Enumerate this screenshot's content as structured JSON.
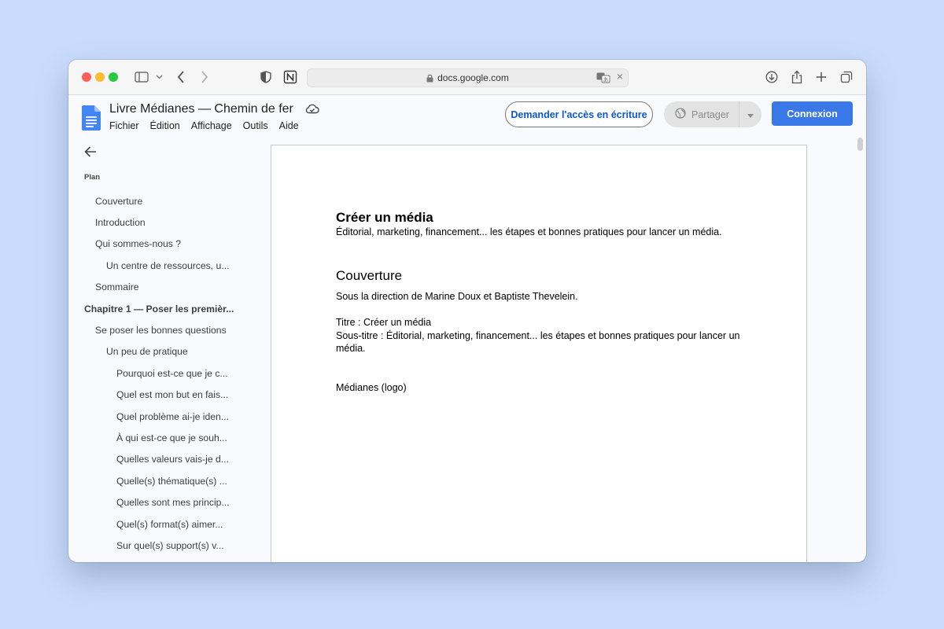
{
  "browser": {
    "url": "docs.google.com"
  },
  "docs": {
    "title": "Livre Médianes — Chemin de fer",
    "menu": [
      "Fichier",
      "Édition",
      "Affichage",
      "Outils",
      "Aide"
    ],
    "request_access_label": "Demander l'accès en écriture",
    "share_label": "Partager",
    "login_label": "Connexion",
    "brand_color": "#3b78e7"
  },
  "outline": {
    "heading": "Plan",
    "items": [
      {
        "label": "Couverture",
        "level": 1
      },
      {
        "label": "Introduction",
        "level": 1
      },
      {
        "label": "Qui sommes-nous ?",
        "level": 1
      },
      {
        "label": "Un centre de ressources, u...",
        "level": 2
      },
      {
        "label": "Sommaire",
        "level": 1
      },
      {
        "label": "Chapitre 1 — Poser les premièr...",
        "level": 0
      },
      {
        "label": "Se poser les bonnes questions",
        "level": 1
      },
      {
        "label": "Un peu de pratique",
        "level": 2
      },
      {
        "label": "Pourquoi est-ce que je c...",
        "level": 3
      },
      {
        "label": "Quel est mon but en fais...",
        "level": 3
      },
      {
        "label": "Quel problème ai-je iden...",
        "level": 3
      },
      {
        "label": "À qui est-ce que je souh...",
        "level": 3
      },
      {
        "label": "Quelles valeurs vais-je d...",
        "level": 3
      },
      {
        "label": "Quelle(s) thématique(s) ...",
        "level": 3
      },
      {
        "label": "Quelles sont mes princip...",
        "level": 3
      },
      {
        "label": "Quel(s) format(s) aimer...",
        "level": 3
      },
      {
        "label": "Sur quel(s) support(s) v...",
        "level": 3
      }
    ]
  },
  "document": {
    "title": "Créer un média",
    "subtitle": "Éditorial, marketing, financement... les étapes et bonnes pratiques pour lancer un média.",
    "section_heading": "Couverture",
    "direction": "Sous la direction de Marine Doux et Baptiste Thevelein.",
    "titre_line": "Titre : Créer un média",
    "sous_titre_line": "Sous-titre : Éditorial, marketing, financement... les étapes et bonnes pratiques pour lancer un média.",
    "logo_line": "Médianes (logo)"
  }
}
